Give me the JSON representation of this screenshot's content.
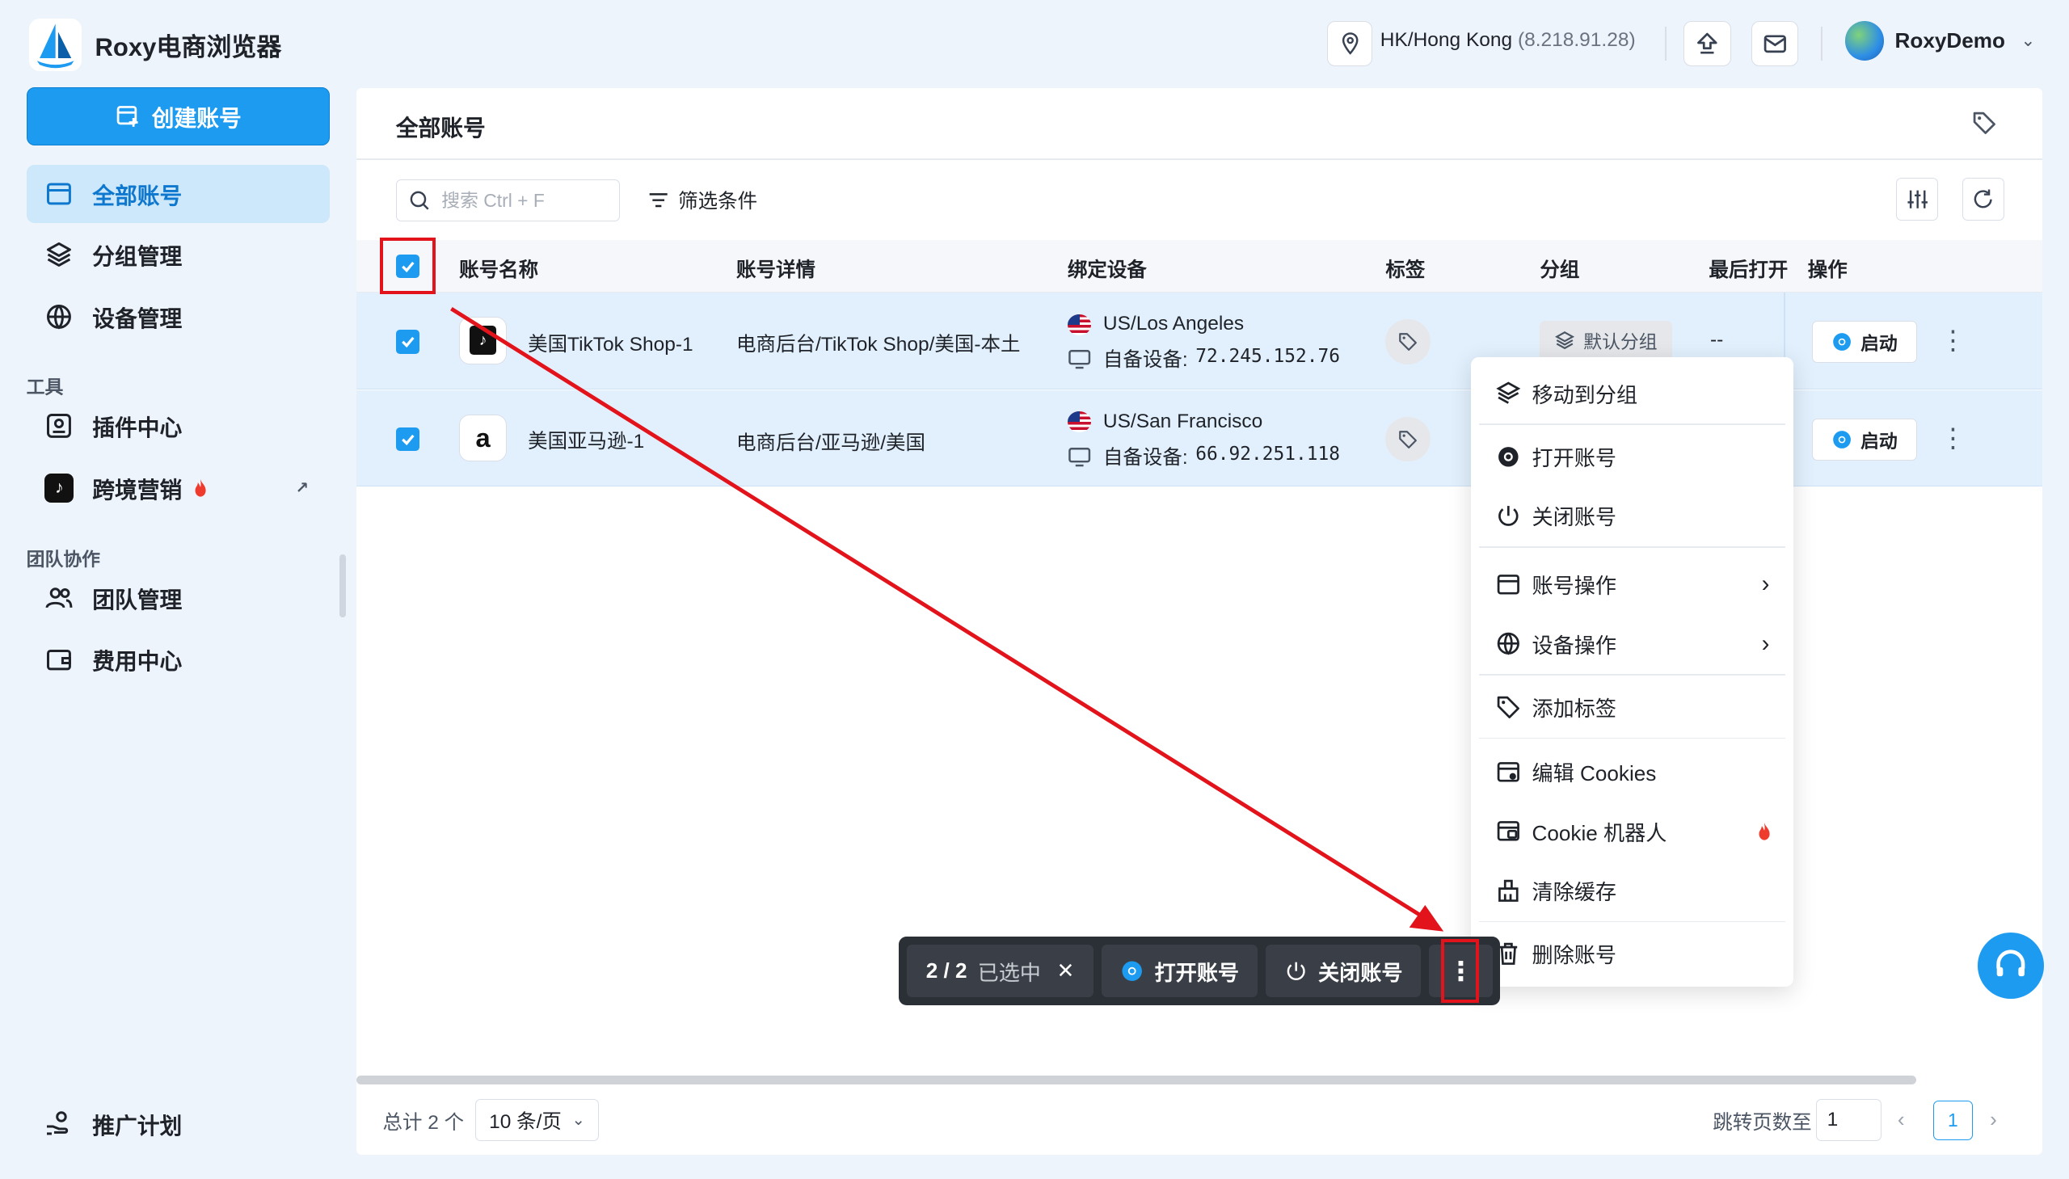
{
  "app": {
    "title": "Roxy电商浏览器"
  },
  "topbar": {
    "location": "HK/Hong Kong",
    "ip": "(8.218.91.28)",
    "user": "RoxyDemo"
  },
  "sidebar": {
    "create_label": "创建账号",
    "items": [
      {
        "label": "全部账号"
      },
      {
        "label": "分组管理"
      },
      {
        "label": "设备管理"
      }
    ],
    "tools_section": "工具",
    "tools": [
      {
        "label": "插件中心"
      },
      {
        "label": "跨境营销"
      }
    ],
    "team_section": "团队协作",
    "team": [
      {
        "label": "团队管理"
      },
      {
        "label": "费用中心"
      }
    ],
    "promo_label": "推广计划"
  },
  "main": {
    "title": "全部账号",
    "search_placeholder": "搜索 Ctrl + F",
    "filter_label": "筛选条件",
    "columns": [
      "账号名称",
      "账号详情",
      "绑定设备",
      "标签",
      "分组",
      "最后打开",
      "操作"
    ],
    "rows": [
      {
        "name": "美国TikTok Shop-1",
        "detail": "电商后台/TikTok Shop/美国-本土",
        "location": "US/Los Angeles",
        "device_label": "自备设备:",
        "device_ip": "72.245.152.76",
        "group": "默认分组",
        "last_open": "--",
        "launch": "启动"
      },
      {
        "name": "美国亚马逊-1",
        "detail": "电商后台/亚马逊/美国",
        "location": "US/San Francisco",
        "device_label": "自备设备:",
        "device_ip": "66.92.251.118",
        "launch": "启动"
      }
    ],
    "footer": {
      "total": "总计 2 个",
      "page_size": "10 条/页",
      "jump_label": "跳转页数至",
      "jump_value": "1",
      "current_page": "1"
    }
  },
  "context_menu": {
    "items": [
      "移动到分组",
      "打开账号",
      "关闭账号",
      "账号操作",
      "设备操作",
      "添加标签",
      "编辑 Cookies",
      "Cookie 机器人",
      "清除缓存",
      "删除账号"
    ]
  },
  "bulk_bar": {
    "count": "2 / 2",
    "selected_label": "已选中",
    "open_label": "打开账号",
    "close_label": "关闭账号"
  },
  "colors": {
    "accent": "#1c9bf0",
    "annotation": "#e3131b",
    "row_selected": "#e2f0fd",
    "bulk_bg": "#2b2f36"
  }
}
